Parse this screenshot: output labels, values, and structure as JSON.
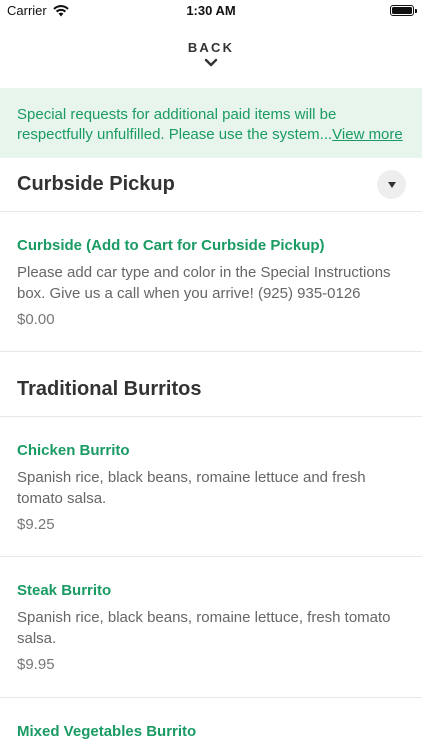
{
  "status_bar": {
    "carrier": "Carrier",
    "time": "1:30 AM"
  },
  "header": {
    "back_label": "BACK"
  },
  "notice": {
    "text": "Special requests for additional paid items will be respectfully unfulfilled. Please use the system...",
    "link_label": "View more"
  },
  "sections": [
    {
      "title": "Curbside Pickup",
      "items": [
        {
          "name": "Curbside (Add to Cart for Curbside Pickup)",
          "description": "Please add car type and color in the Special Instructions box. Give us a call when you arrive! (925) 935-0126",
          "price": "$0.00"
        }
      ]
    },
    {
      "title": "Traditional Burritos",
      "items": [
        {
          "name": "Chicken Burrito",
          "description": "Spanish rice, black beans, romaine lettuce and fresh tomato salsa.",
          "price": "$9.25"
        },
        {
          "name": "Steak Burrito",
          "description": "Spanish rice, black beans, romaine lettuce, fresh tomato salsa.",
          "price": "$9.95"
        },
        {
          "name": "Mixed Vegetables Burrito",
          "description": "",
          "price": ""
        }
      ]
    }
  ],
  "colors": {
    "accent_green": "#1a9b63",
    "notice_bg": "#e8f5ec",
    "divider": "#e8e8e8"
  },
  "icons": {
    "wifi": "wifi-icon",
    "battery": "battery-icon",
    "back": "chevron-down-icon",
    "dropdown": "caret-down-icon"
  }
}
